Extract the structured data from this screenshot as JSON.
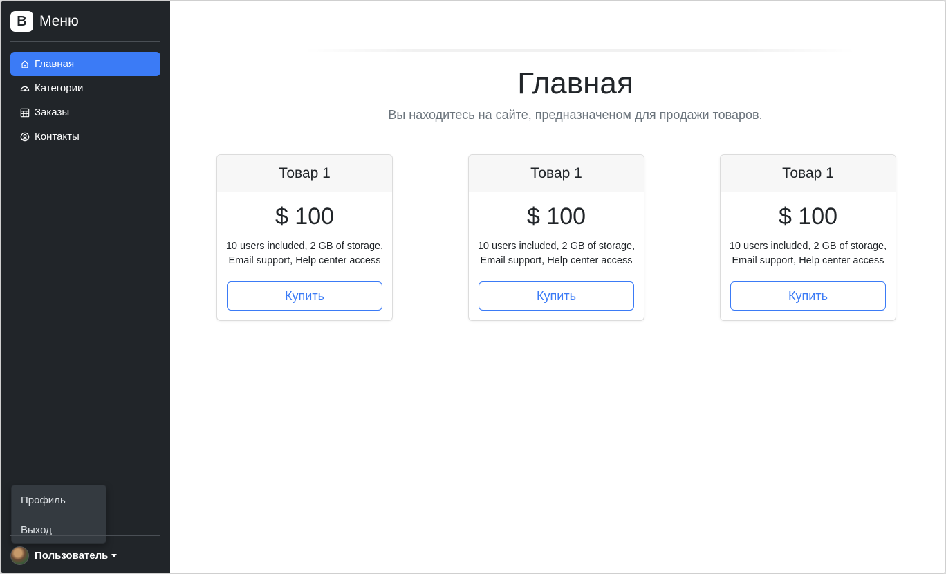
{
  "sidebar": {
    "brand": {
      "logo_letter": "B",
      "title": "Меню"
    },
    "nav": [
      {
        "label": "Главная",
        "icon": "home-icon",
        "active": true
      },
      {
        "label": "Категории",
        "icon": "speedometer-icon",
        "active": false
      },
      {
        "label": "Заказы",
        "icon": "table-icon",
        "active": false
      },
      {
        "label": "Контакты",
        "icon": "person-circle-icon",
        "active": false
      }
    ],
    "user_menu": {
      "items": [
        "Профиль",
        "Выход"
      ]
    },
    "user": {
      "name": "Пользователь"
    }
  },
  "main": {
    "title": "Главная",
    "lead": "Вы находитесь на сайте, предназначеном для продажи товаров.",
    "cards": [
      {
        "title": "Товар 1",
        "price": "$ 100",
        "desc_line1": "10 users included, 2 GB of storage,",
        "desc_line2": "Email support, Help center access",
        "button": "Купить"
      },
      {
        "title": "Товар 1",
        "price": "$ 100",
        "desc_line1": "10 users included, 2 GB of storage,",
        "desc_line2": "Email support, Help center access",
        "button": "Купить"
      },
      {
        "title": "Товар 1",
        "price": "$ 100",
        "desc_line1": "10 users included, 2 GB of storage,",
        "desc_line2": "Email support, Help center access",
        "button": "Купить"
      }
    ]
  },
  "colors": {
    "sidebar_bg": "#212529",
    "accent": "#3b7bf6",
    "dropdown_bg": "#343a40"
  }
}
